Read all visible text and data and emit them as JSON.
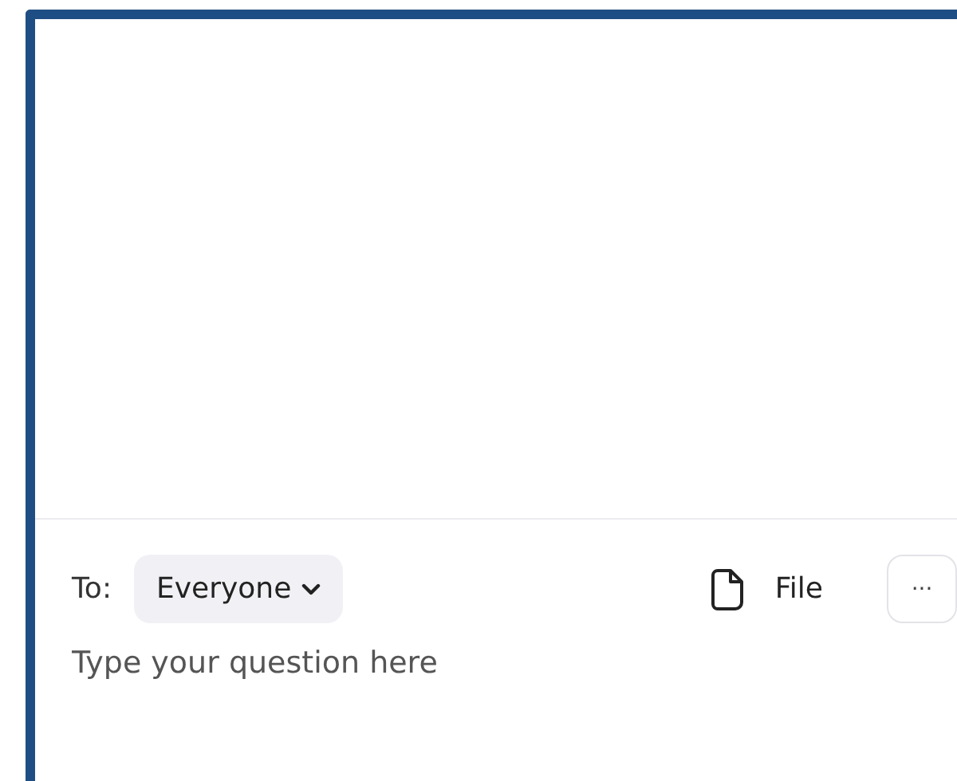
{
  "composer": {
    "to_label": "To:",
    "recipient": "Everyone",
    "file_button": "File",
    "more_button": "···",
    "input": {
      "placeholder": "Type your question here"
    }
  }
}
